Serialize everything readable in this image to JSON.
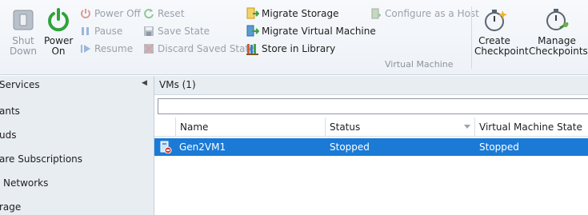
{
  "ribbon": {
    "shut_down": "Shut Down",
    "power_on": "Power On",
    "power_off": "Power Off",
    "pause": "Pause",
    "resume": "Resume",
    "reset": "Reset",
    "save_state": "Save State",
    "discard_saved_state": "Discard Saved State",
    "migrate_storage": "Migrate Storage",
    "migrate_vm": "Migrate Virtual Machine",
    "store_in_library": "Store in Library",
    "configure_as_host": "Configure as a Host",
    "group_virtual_machine": "Virtual Machine",
    "create_checkpoint": "Create Checkpoint",
    "manage_checkpoints": "Manage Checkpoints"
  },
  "nav": {
    "title": "Services",
    "items": [
      "ants",
      "uds",
      "are Subscriptions",
      "Networks",
      "rage"
    ]
  },
  "main": {
    "header": "VMs (1)",
    "search_value": "",
    "columns": [
      "Name",
      "Status",
      "Virtual Machine State"
    ],
    "rows": [
      {
        "name": "Gen2VM1",
        "status": "Stopped",
        "state": "Stopped"
      }
    ]
  },
  "colors": {
    "selection": "#1a7ad6",
    "power_green": "#2fa33a",
    "nav_bg": "#e8edf2"
  },
  "icons": [
    "shutdown-icon",
    "power-on-icon",
    "power-off-icon",
    "pause-icon",
    "resume-icon",
    "reset-icon",
    "save-state-icon",
    "discard-saved-state-icon",
    "migrate-storage-icon",
    "migrate-vm-icon",
    "store-in-library-icon",
    "configure-host-icon",
    "create-checkpoint-icon",
    "manage-checkpoints-icon",
    "vm-stopped-icon"
  ]
}
